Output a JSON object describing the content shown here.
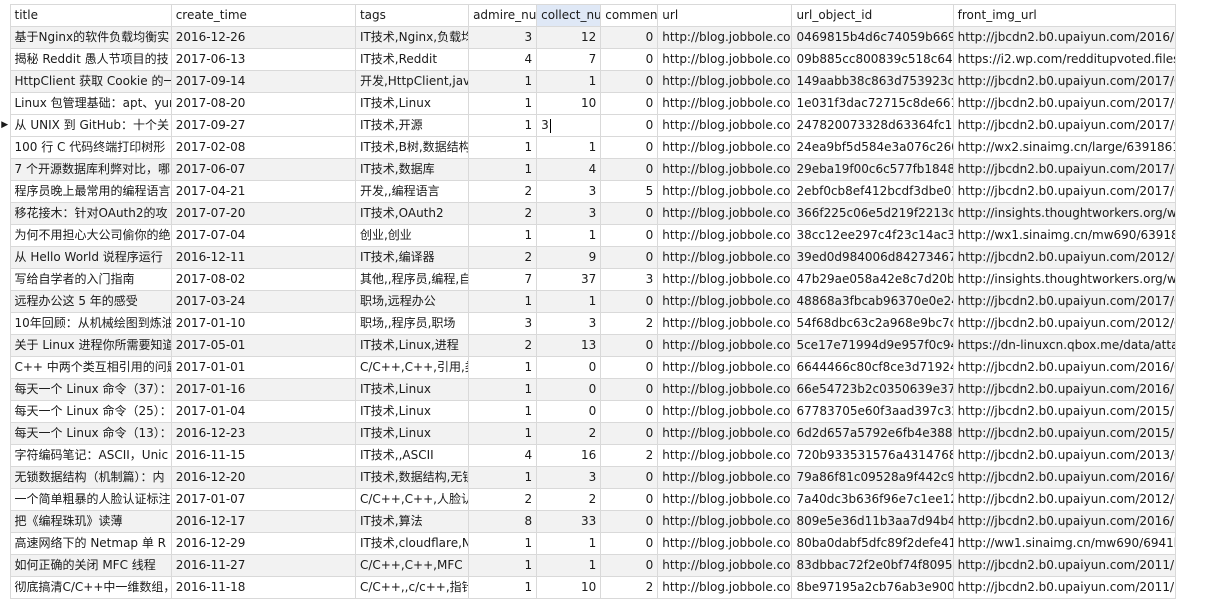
{
  "columns": [
    "title",
    "create_time",
    "tags",
    "admire_num",
    "collect_num",
    "comment_num",
    "url",
    "url_object_id",
    "front_img_url"
  ],
  "headers_display": [
    "title",
    "create_time",
    "tags",
    "admire_nur",
    "collect_nur",
    "comment",
    "url",
    "url_object_id",
    "front_img_url"
  ],
  "selected_column": "collect_num",
  "current_row_marker": "▶",
  "rows": [
    {
      "title": "基于Nginx的软件负载均衡实",
      "create_time": "2016-12-26",
      "tags": "IT技术,Nginx,负载均",
      "admire": "3",
      "collect": "12",
      "comment": "0",
      "url": "http://blog.jobbole.com",
      "url_object_id": "0469815b4d6c74059b669c",
      "front_img_url": "http://jbcdn2.b0.upaiyun.com/2016/12"
    },
    {
      "title": "揭秘 Reddit 愚人节项目的技",
      "create_time": "2017-06-13",
      "tags": "IT技术,Reddit",
      "admire": "4",
      "collect": "7",
      "comment": "0",
      "url": "http://blog.jobbole.com",
      "url_object_id": "09b885cc800839c518c644",
      "front_img_url": "https://i2.wp.com/redditupvoted.files."
    },
    {
      "title": "HttpClient 获取 Cookie 的一",
      "create_time": "2017-09-14",
      "tags": "开发,HttpClient,java",
      "admire": "1",
      "collect": "1",
      "comment": "0",
      "url": "http://blog.jobbole.com",
      "url_object_id": "149aabb38c863d753923c7",
      "front_img_url": "http://jbcdn2.b0.upaiyun.com/2017/09"
    },
    {
      "title": "Linux 包管理基础：apt、yur",
      "create_time": "2017-08-20",
      "tags": "IT技术,Linux",
      "admire": "1",
      "collect": "10",
      "comment": "0",
      "url": "http://blog.jobbole.com",
      "url_object_id": "1e031f3dac72715c8de661c",
      "front_img_url": "http://jbcdn2.b0.upaiyun.com/2017/05"
    },
    {
      "title": "从 UNIX 到 GitHub：十个关",
      "create_time": "2017-09-27",
      "tags": "IT技术,开源",
      "admire": "1",
      "collect": "3",
      "comment": "0",
      "url": "http://blog.jobbole.com",
      "url_object_id": "247820073328d63364fc16",
      "front_img_url": "http://jbcdn2.b0.upaiyun.com/2017/09"
    },
    {
      "title": "100 行 C 代码终端打印树形",
      "create_time": "2017-02-08",
      "tags": "IT技术,B树,数据结构",
      "admire": "1",
      "collect": "1",
      "comment": "0",
      "url": "http://blog.jobbole.com",
      "url_object_id": "24ea9bf5d584e3a076c260",
      "front_img_url": "http://wx2.sinaimg.cn/large/63918611"
    },
    {
      "title": "7 个开源数据库利弊对比，哪",
      "create_time": "2017-06-07",
      "tags": "IT技术,数据库",
      "admire": "1",
      "collect": "4",
      "comment": "0",
      "url": "http://blog.jobbole.com",
      "url_object_id": "29eba19f00c6c577fb1848f",
      "front_img_url": "http://jbcdn2.b0.upaiyun.com/2017/06"
    },
    {
      "title": "程序员晚上最常用的编程语言",
      "create_time": "2017-04-21",
      "tags": "开发,,编程语言",
      "admire": "2",
      "collect": "3",
      "comment": "5",
      "url": "http://blog.jobbole.com",
      "url_object_id": "2ebf0cb8ef412bcdf3dbe01",
      "front_img_url": "http://jbcdn2.b0.upaiyun.com/2017/04"
    },
    {
      "title": "移花接木：针对OAuth2的攻",
      "create_time": "2017-07-20",
      "tags": "IT技术,OAuth2",
      "admire": "2",
      "collect": "3",
      "comment": "0",
      "url": "http://blog.jobbole.com",
      "url_object_id": "366f225c06e5d219f2213ca",
      "front_img_url": "http://insights.thoughtworkers.org/wp"
    },
    {
      "title": "为何不用担心大公司偷你的绝",
      "create_time": "2017-07-04",
      "tags": "创业,创业",
      "admire": "1",
      "collect": "1",
      "comment": "0",
      "url": "http://blog.jobbole.com",
      "url_object_id": "38cc12ee297c4f23c14ac3d",
      "front_img_url": "http://wx1.sinaimg.cn/mw690/6391861"
    },
    {
      "title": "从 Hello World 说程序运行",
      "create_time": "2016-12-11",
      "tags": "IT技术,编译器",
      "admire": "2",
      "collect": "9",
      "comment": "0",
      "url": "http://blog.jobbole.com",
      "url_object_id": "39ed0d984006d84273467c",
      "front_img_url": "http://jbcdn2.b0.upaiyun.com/2012/03"
    },
    {
      "title": "写给自学者的入门指南",
      "create_time": "2017-08-02",
      "tags": "其他,,程序员,编程,自",
      "admire": "7",
      "collect": "37",
      "comment": "3",
      "url": "http://blog.jobbole.com",
      "url_object_id": "47b29ae058a42e8c7d20bb",
      "front_img_url": "http://insights.thoughtworkers.org/wp"
    },
    {
      "title": "远程办公这 5 年的感受",
      "create_time": "2017-03-24",
      "tags": "职场,远程办公",
      "admire": "1",
      "collect": "1",
      "comment": "0",
      "url": "http://blog.jobbole.com",
      "url_object_id": "48868a3fbcab96370e0e24",
      "front_img_url": "http://jbcdn2.b0.upaiyun.com/2017/03"
    },
    {
      "title": "10年回顾：从机械绘图到炼油",
      "create_time": "2017-01-10",
      "tags": "职场,,程序员,职场",
      "admire": "3",
      "collect": "3",
      "comment": "2",
      "url": "http://blog.jobbole.com",
      "url_object_id": "54f68dbc63c2a968e9bc7cc",
      "front_img_url": "http://jbcdn2.b0.upaiyun.com/2012/03"
    },
    {
      "title": "关于 Linux 进程你所需要知道",
      "create_time": "2017-05-01",
      "tags": "IT技术,Linux,进程",
      "admire": "2",
      "collect": "13",
      "comment": "0",
      "url": "http://blog.jobbole.com",
      "url_object_id": "5ce17e71994d9e957f0c942",
      "front_img_url": "https://dn-linuxcn.qbox.me/data/attac"
    },
    {
      "title": "C++ 中两个类互相引用的问题",
      "create_time": "2017-01-01",
      "tags": "C/C++,C++,引用,类",
      "admire": "1",
      "collect": "0",
      "comment": "0",
      "url": "http://blog.jobbole.com",
      "url_object_id": "6644466c80cf8ce3d71924c",
      "front_img_url": "http://jbcdn2.b0.upaiyun.com/2016/05"
    },
    {
      "title": "每天一个 Linux 命令（37）：",
      "create_time": "2017-01-16",
      "tags": "IT技术,Linux",
      "admire": "1",
      "collect": "0",
      "comment": "0",
      "url": "http://blog.jobbole.com",
      "url_object_id": "66e54723b2c0350639e37f1",
      "front_img_url": "http://jbcdn2.b0.upaiyun.com/2016/11"
    },
    {
      "title": "每天一个 Linux 命令（25）：",
      "create_time": "2017-01-04",
      "tags": "IT技术,Linux",
      "admire": "1",
      "collect": "0",
      "comment": "0",
      "url": "http://blog.jobbole.com",
      "url_object_id": "67783705e60f3aad397c32",
      "front_img_url": "http://jbcdn2.b0.upaiyun.com/2015/10"
    },
    {
      "title": "每天一个 Linux 命令（13）：",
      "create_time": "2016-12-23",
      "tags": "IT技术,Linux",
      "admire": "1",
      "collect": "2",
      "comment": "0",
      "url": "http://blog.jobbole.com",
      "url_object_id": "6d2d657a5792e6fb4e3885",
      "front_img_url": "http://jbcdn2.b0.upaiyun.com/2015/10"
    },
    {
      "title": "字符编码笔记：ASCII，Unic",
      "create_time": "2016-11-15",
      "tags": "IT技术,,ASCII",
      "admire": "4",
      "collect": "16",
      "comment": "2",
      "url": "http://blog.jobbole.com",
      "url_object_id": "720b933531576a4314768c",
      "front_img_url": "http://jbcdn2.b0.upaiyun.com/2013/06"
    },
    {
      "title": "无锁数据结构（机制篇）：内",
      "create_time": "2016-12-20",
      "tags": "IT技术,数据结构,无锁",
      "admire": "1",
      "collect": "3",
      "comment": "0",
      "url": "http://blog.jobbole.com",
      "url_object_id": "79a86f81c09528a9f442c98",
      "front_img_url": "http://jbcdn2.b0.upaiyun.com/2016/04"
    },
    {
      "title": "一个简单粗暴的人脸认证标注",
      "create_time": "2017-01-07",
      "tags": "C/C++,C++,人脸认",
      "admire": "2",
      "collect": "2",
      "comment": "0",
      "url": "http://blog.jobbole.com",
      "url_object_id": "7a40dc3b636f96e7c1ee12f",
      "front_img_url": "http://jbcdn2.b0.upaiyun.com/2012/03"
    },
    {
      "title": "把《编程珠玑》读薄",
      "create_time": "2016-12-17",
      "tags": "IT技术,算法",
      "admire": "8",
      "collect": "33",
      "comment": "0",
      "url": "http://blog.jobbole.com",
      "url_object_id": "809e5e36d11b3aa7d94b47",
      "front_img_url": "http://jbcdn2.b0.upaiyun.com/2016/12"
    },
    {
      "title": "高速网络下的 Netmap 单 R",
      "create_time": "2016-12-29",
      "tags": "IT技术,cloudflare,N",
      "admire": "1",
      "collect": "1",
      "comment": "0",
      "url": "http://blog.jobbole.com",
      "url_object_id": "80ba0dabf5dfc89f2defe41",
      "front_img_url": "http://ww1.sinaimg.cn/mw690/6941ba"
    },
    {
      "title": "如何正确的关闭 MFC 线程",
      "create_time": "2016-11-27",
      "tags": "C/C++,C++,MFC",
      "admire": "1",
      "collect": "1",
      "comment": "0",
      "url": "http://blog.jobbole.com",
      "url_object_id": "83dbbac72f2e0bf74f8095c",
      "front_img_url": "http://jbcdn2.b0.upaiyun.com/2011/11"
    },
    {
      "title": "彻底搞清C/C++中一维数组，",
      "create_time": "2016-11-18",
      "tags": "C/C++,,c/c++,指针,",
      "admire": "1",
      "collect": "10",
      "comment": "2",
      "url": "http://blog.jobbole.com",
      "url_object_id": "8be97195a2cb76ab3e9009",
      "front_img_url": "http://jbcdn2.b0.upaiyun.com/2011/11"
    }
  ],
  "current_row_index": 4,
  "editing_cell": {
    "row": 4,
    "column": "collect_num",
    "value": "3"
  }
}
